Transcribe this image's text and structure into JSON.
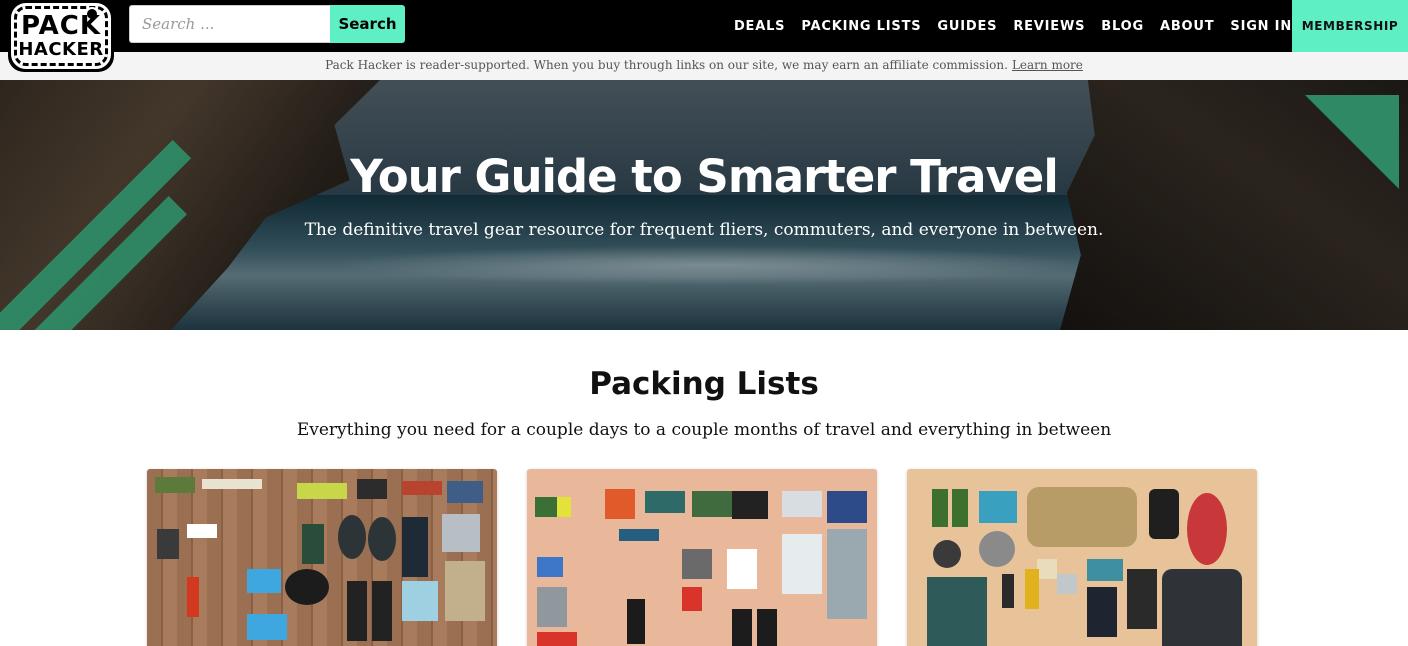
{
  "logo": {
    "line1": "PACK",
    "line2": "HACKER"
  },
  "search": {
    "placeholder": "Search ...",
    "button_label": "Search"
  },
  "nav": {
    "items": [
      "DEALS",
      "PACKING LISTS",
      "GUIDES",
      "REVIEWS",
      "BLOG",
      "ABOUT",
      "SIGN IN"
    ],
    "membership": "MEMBERSHIP"
  },
  "disclosure": {
    "text": "Pack Hacker is reader-supported. When you buy through links on our site, we may earn an affiliate commission.",
    "link": "Learn more"
  },
  "hero": {
    "title": "Your Guide to Smarter Travel",
    "subtitle": "The definitive travel gear resource for frequent fliers, commuters, and everyone in between."
  },
  "section": {
    "title": "Packing Lists",
    "subtitle": "Everything you need for a couple days to a couple months of travel and everything in between"
  },
  "colors": {
    "accent": "#5ef0c4",
    "stripe_green": "#2f8f68",
    "nav_bg": "#000000"
  }
}
